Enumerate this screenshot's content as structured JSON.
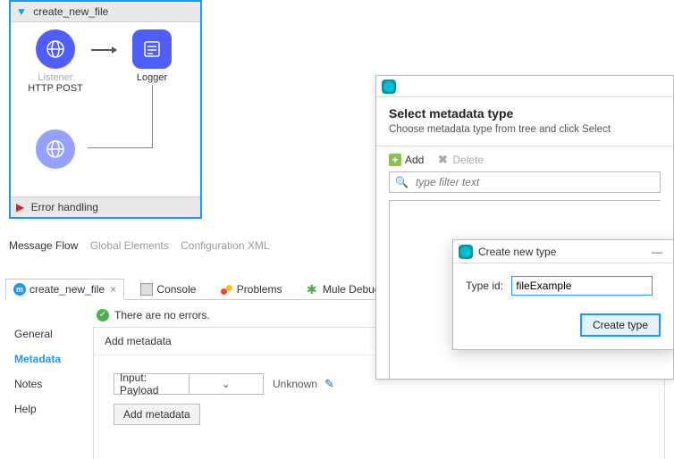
{
  "flow": {
    "name": "create_new_file",
    "nodes": {
      "listener": {
        "label1": "Listener",
        "label2": "HTTP POST"
      },
      "logger": {
        "label1": "Logger",
        "label2": ""
      }
    },
    "error_handling": "Error handling"
  },
  "subtabs": {
    "message_flow": "Message Flow",
    "global_elements": "Global Elements",
    "config_xml": "Configuration XML"
  },
  "editor_tabs": {
    "active": "create_new_file",
    "console": "Console",
    "problems": "Problems",
    "mule_debug": "Mule Debug"
  },
  "status": {
    "no_errors": "There are no errors."
  },
  "sidenav": {
    "general": "General",
    "metadata": "Metadata",
    "notes": "Notes",
    "help": "Help"
  },
  "content": {
    "header": "Add metadata",
    "input_label": "Input: Payload",
    "unknown_label": "Unknown",
    "add_btn": "Add metadata"
  },
  "dlg_select": {
    "heading": "Select metadata type",
    "sub": "Choose metadata type from tree and click Select",
    "add": "Add",
    "delete": "Delete",
    "filter_placeholder": "type filter text"
  },
  "dlg_create": {
    "title": "Create new type",
    "typeid_label": "Type id:",
    "typeid_value": "fileExample",
    "create_btn": "Create type"
  }
}
